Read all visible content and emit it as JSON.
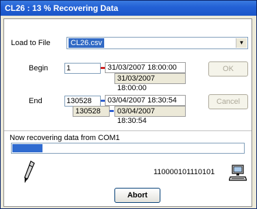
{
  "window": {
    "title": "CL26 : 13 % Recovering Data"
  },
  "load": {
    "label": "Load to File",
    "file": "CL26.csv"
  },
  "begin": {
    "label": "Begin",
    "input": "1",
    "datetime_top": "31/03/2007 18:00:00",
    "datetime_bottom": "31/03/2007 18:00:00",
    "marker_color": "#d02020"
  },
  "end": {
    "label": "End",
    "input": "130528",
    "input_echo": "130528",
    "datetime_top": "03/04/2007 18:30:54",
    "datetime_bottom": "03/04/2007 18:30:54",
    "marker_color": "#3060d0"
  },
  "buttons": {
    "ok": "OK",
    "cancel": "Cancel",
    "abort": "Abort"
  },
  "status": {
    "message": "Now recovering data from COM1",
    "bits": "110000101110101",
    "progress": 0.13
  },
  "icons": {
    "pen": "pen-icon",
    "computer": "computer-icon"
  },
  "colors": {
    "title_bar": "#2462d6",
    "progress": "#2f6bd0"
  }
}
